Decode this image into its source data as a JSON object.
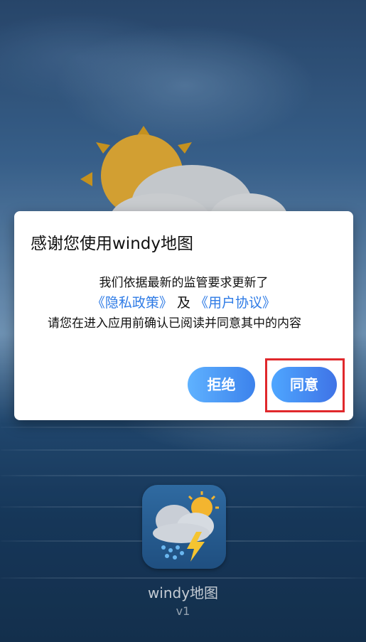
{
  "dialog": {
    "title": "感谢您使用windy地图",
    "line1": "我们依据最新的监管要求更新了",
    "privacy_link": "《隐私政策》",
    "conjunction": "及",
    "agreement_link": "《用户协议》",
    "line3": "请您在进入应用前确认已阅读并同意其中的内容",
    "reject_label": "拒绝",
    "agree_label": "同意"
  },
  "app": {
    "name": "windy地图",
    "version": "v1",
    "icon": "weather-cloud-sun-lightning-icon"
  },
  "colors": {
    "link": "#2e7be6",
    "button_gradient_start": "#5fb2ff",
    "button_gradient_end": "#3c82ec",
    "highlight": "#e0282c"
  }
}
